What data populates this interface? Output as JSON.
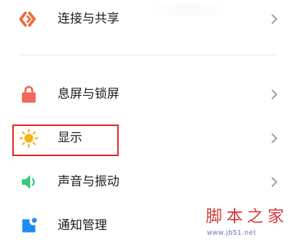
{
  "settings": {
    "items": [
      {
        "label": "连接与共享",
        "icon": "share-link-icon",
        "color": "#f0693a"
      },
      {
        "label": "息屏与锁屏",
        "icon": "lock-icon",
        "color": "#f0685c"
      },
      {
        "label": "显示",
        "icon": "sun-icon",
        "color": "#f5b41a"
      },
      {
        "label": "声音与振动",
        "icon": "speaker-icon",
        "color": "#35c97b"
      },
      {
        "label": "通知管理",
        "icon": "notification-icon",
        "color": "#1f8cf0"
      }
    ]
  },
  "highlight": {
    "color": "#e3151a"
  },
  "watermark": {
    "title": "脚本之家",
    "url": "www.jb51.net"
  }
}
